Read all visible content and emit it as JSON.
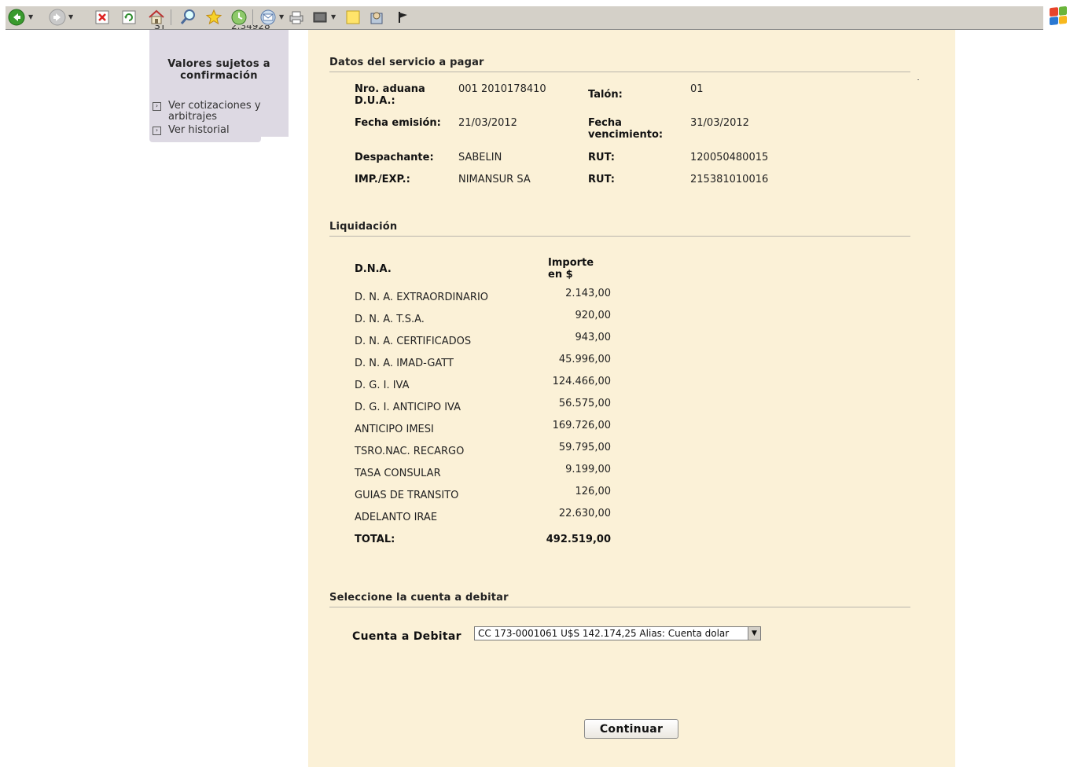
{
  "toolbar": {
    "icons": [
      "back-icon",
      "forward-icon",
      "stop-icon",
      "refresh-icon",
      "home-icon",
      "search-icon",
      "favorites-icon",
      "history-icon",
      "mail-icon",
      "print-icon",
      "edit-icon",
      "notes-icon",
      "messenger-icon",
      "flag-icon"
    ]
  },
  "sidebar": {
    "cut_left": "ST",
    "cut_right": "2.34928",
    "title": "Valores sujetos a confirmación",
    "links": [
      {
        "label": "Ver cotizaciones y arbitrajes"
      },
      {
        "label": "Ver historial"
      }
    ]
  },
  "servicio": {
    "title": "Datos del servicio a pagar",
    "fields": [
      {
        "label": "Nro. aduana D.U.A.:",
        "value": "001 2010178410"
      },
      {
        "label": "Talón:",
        "value": "01"
      },
      {
        "label": "Fecha emisión:",
        "value": "21/03/2012"
      },
      {
        "label": "Fecha vencimiento:",
        "value": "31/03/2012"
      },
      {
        "label": "Despachante:",
        "value": "SABELIN"
      },
      {
        "label": "RUT:",
        "value": "120050480015"
      },
      {
        "label": "IMP./EXP.:",
        "value": "NIMANSUR SA"
      },
      {
        "label": "RUT:",
        "value": "215381010016"
      }
    ]
  },
  "liquidacion": {
    "title": "Liquidación",
    "col_name": "D.N.A.",
    "col_amount": "Importe en $",
    "rows": [
      {
        "name": "D. N. A. EXTRAORDINARIO",
        "amount": "2.143,00"
      },
      {
        "name": "D. N. A. T.S.A.",
        "amount": "920,00"
      },
      {
        "name": "D. N. A. CERTIFICADOS",
        "amount": "943,00"
      },
      {
        "name": "D. N. A. IMAD-GATT",
        "amount": "45.996,00"
      },
      {
        "name": "D. G. I. IVA",
        "amount": "124.466,00"
      },
      {
        "name": "D. G. I. ANTICIPO IVA",
        "amount": "56.575,00"
      },
      {
        "name": "ANTICIPO IMESI",
        "amount": "169.726,00"
      },
      {
        "name": "TSRO.NAC. RECARGO",
        "amount": "59.795,00"
      },
      {
        "name": "TASA CONSULAR",
        "amount": "9.199,00"
      },
      {
        "name": "GUIAS DE TRANSITO",
        "amount": "126,00"
      },
      {
        "name": "ADELANTO IRAE",
        "amount": "22.630,00"
      }
    ],
    "total_label": "TOTAL:",
    "total_amount": "492.519,00"
  },
  "cuenta": {
    "title": "Seleccione la cuenta a debitar",
    "label": "Cuenta a Debitar",
    "selected": "CC 173-0001061 U$S 142.174,25 Alias: Cuenta dolar"
  },
  "actions": {
    "continue_label": "Continuar"
  }
}
